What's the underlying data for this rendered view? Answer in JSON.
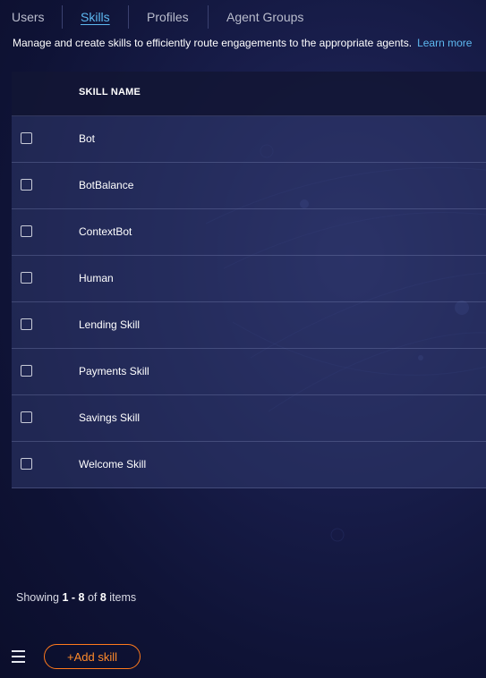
{
  "tabs": [
    {
      "label": "Users"
    },
    {
      "label": "Skills"
    },
    {
      "label": "Profiles"
    },
    {
      "label": "Agent Groups"
    }
  ],
  "description": {
    "text": "Manage and create skills to efficiently route engagements to the appropriate agents.",
    "learn_more": "Learn more"
  },
  "table": {
    "header": "SKILL NAME",
    "rows": [
      {
        "name": "Bot"
      },
      {
        "name": "BotBalance"
      },
      {
        "name": "ContextBot"
      },
      {
        "name": "Human"
      },
      {
        "name": "Lending Skill"
      },
      {
        "name": "Payments Skill"
      },
      {
        "name": "Savings Skill"
      },
      {
        "name": "Welcome Skill"
      }
    ]
  },
  "pagination": {
    "prefix": "Showing",
    "range": "1 - 8",
    "of": "of",
    "total": "8",
    "suffix": "items"
  },
  "footer": {
    "add_label": "+Add skill",
    "menu_icon": "hamburger-menu-icon"
  },
  "colors": {
    "accent": "#5db8f0",
    "add_button": "#ff7a1c",
    "background": "#0f1336"
  }
}
